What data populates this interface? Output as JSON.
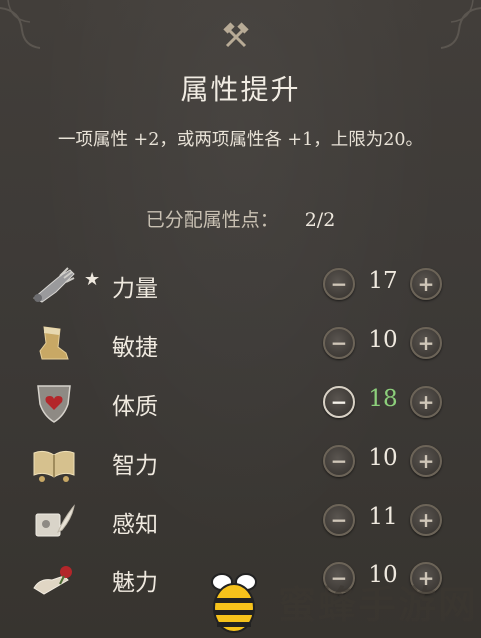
{
  "header": {
    "icon": "crossed-hammers-icon",
    "title": "属性提升",
    "description": "一项属性 +2，或两项属性各 +1，上限为20。"
  },
  "allocation": {
    "label": "已分配属性点：",
    "value": "2/2"
  },
  "buttons": {
    "minus_label": "−",
    "plus_label": "+"
  },
  "attributes": [
    {
      "id": "strength",
      "label": "力量",
      "value": "17",
      "starred": "★",
      "icon": "gauntlet-icon",
      "changed": false
    },
    {
      "id": "dexterity",
      "label": "敏捷",
      "value": "10",
      "starred": "",
      "icon": "boot-icon",
      "changed": false
    },
    {
      "id": "constitution",
      "label": "体质",
      "value": "18",
      "starred": "",
      "icon": "shield-heart-icon",
      "changed": true
    },
    {
      "id": "intelligence",
      "label": "智力",
      "value": "10",
      "starred": "",
      "icon": "open-book-icon",
      "changed": false
    },
    {
      "id": "wisdom",
      "label": "感知",
      "value": "11",
      "starred": "",
      "icon": "scroll-quill-icon",
      "changed": false
    },
    {
      "id": "charisma",
      "label": "魅力",
      "value": "10",
      "starred": "",
      "icon": "hand-rose-icon",
      "changed": false
    }
  ],
  "colors": {
    "background": "#3e3b38",
    "text": "#efe9df",
    "changed_value": "#8ccf7b",
    "button_border": "#6c6458"
  },
  "watermark": {
    "text": "蜜蜂手游网",
    "icon": "bee-logo-icon"
  }
}
